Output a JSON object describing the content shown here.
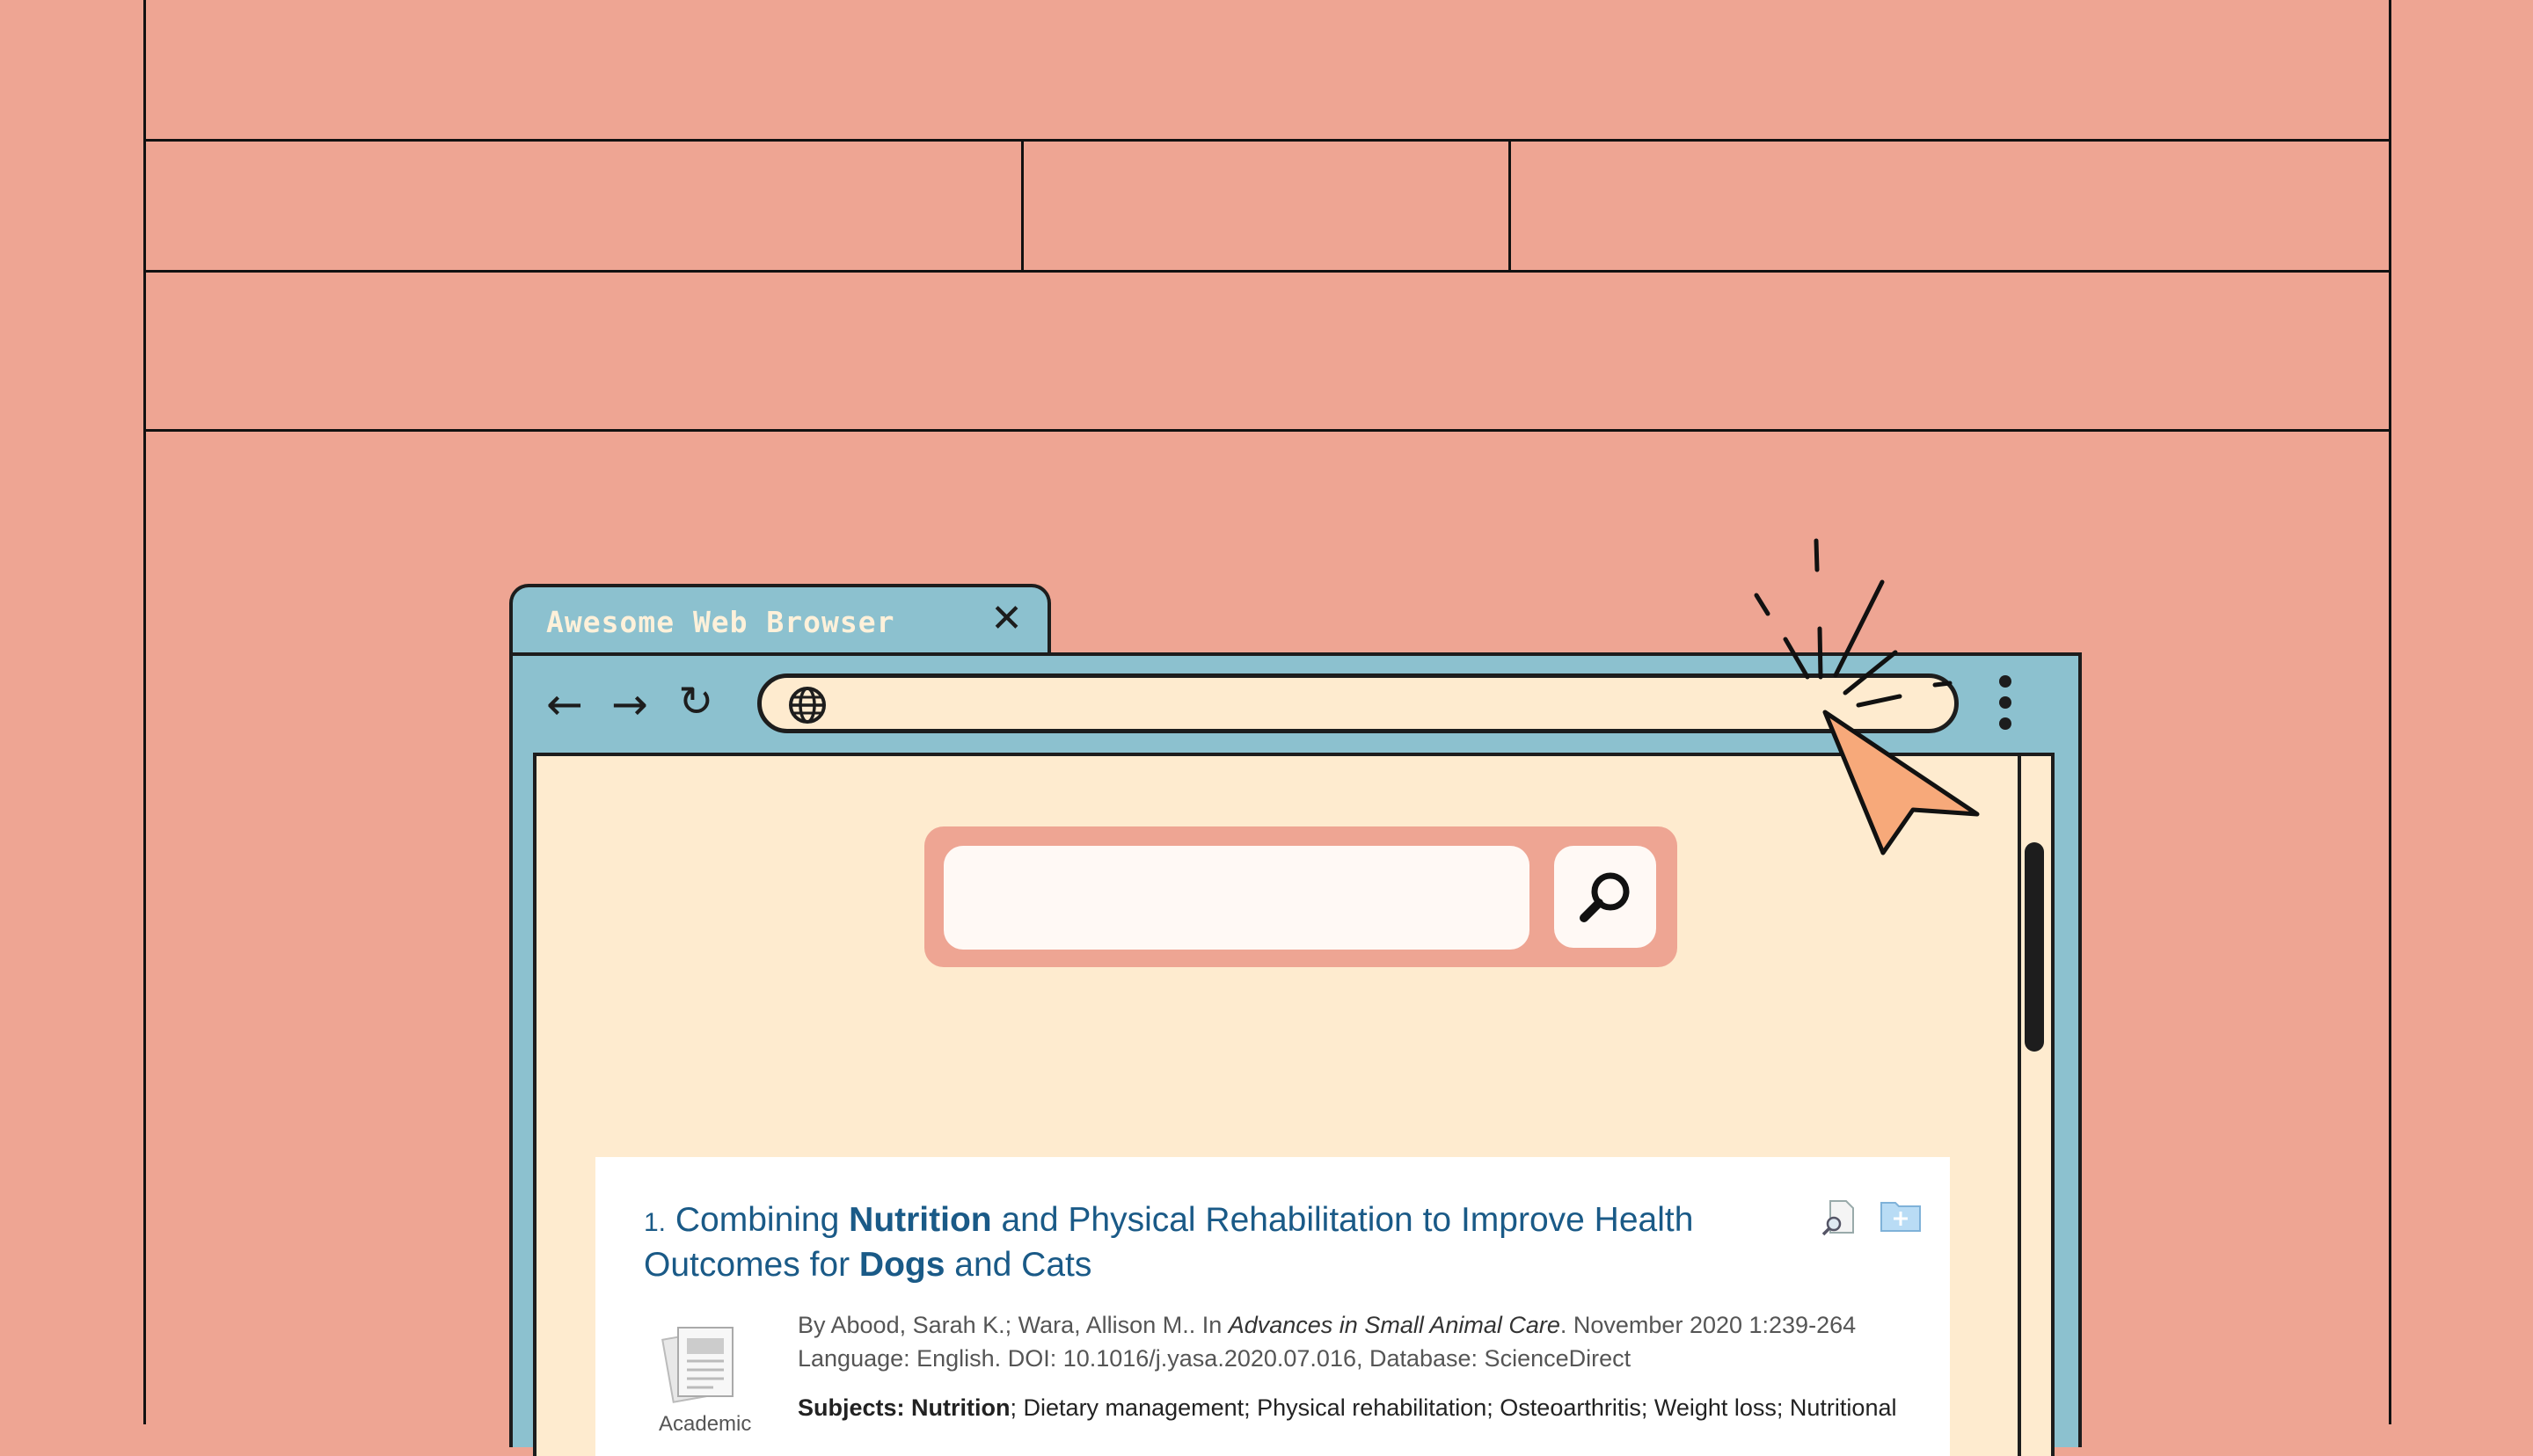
{
  "browser": {
    "tab_title": "Awesome Web Browser",
    "tab_close": "✕",
    "nav": {
      "back": "←",
      "forward": "→",
      "reload": "↻"
    }
  },
  "search": {
    "placeholder": ""
  },
  "result": {
    "number": "1.",
    "title_parts": [
      "Combining ",
      "Nutrition",
      " and Physical Rehabilitation to Improve Health Outcomes for ",
      "Dogs",
      " and Cats"
    ],
    "byline_prefix": "By Abood, Sarah K.; Wara, Allison M.. In ",
    "journal": "Advances in Small Animal Care",
    "byline_suffix": ". November 2020 1:239-264",
    "language_line": "Language: English. DOI: 10.1016/j.yasa.2020.07.016, Database: ScienceDirect",
    "subjects_label": "Subjects:",
    "subjects_first": "Nutrition",
    "subjects_rest": "; Dietary management; Physical rehabilitation; Osteoarthritis; Weight loss; Nutritional",
    "doc_type": "Academic"
  },
  "colors": {
    "background": "#EEA593",
    "window": "#8CC1CF",
    "page": "#FEEBCF",
    "link": "#1a5a87",
    "cursor": "#F7A97A"
  },
  "icons": [
    "close-icon",
    "back-arrow-icon",
    "forward-arrow-icon",
    "reload-icon",
    "globe-icon",
    "more-vert-icon",
    "search-icon",
    "document-icon",
    "preview-icon",
    "add-to-folder-icon",
    "cursor-icon"
  ]
}
